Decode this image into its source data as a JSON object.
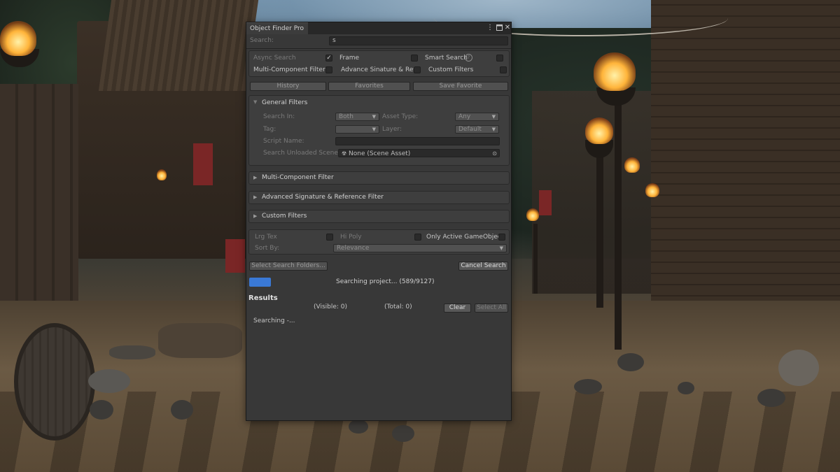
{
  "window": {
    "tab_title": "Object Finder Pro",
    "menu_icon": "kebab-menu-icon",
    "maximize_icon": "maximize-icon",
    "close_icon": "close-icon",
    "close_glyph": "✕"
  },
  "search": {
    "label": "Search:",
    "value": "s"
  },
  "options": {
    "async_search": {
      "label": "Async Search",
      "checked": true,
      "check_glyph": "✓"
    },
    "frame": {
      "label": "Frame",
      "checked": false
    },
    "smart_search": {
      "label": "Smart Search",
      "checked": false,
      "help_icon": "help-icon",
      "help_glyph": "?"
    },
    "multi_component_filter": {
      "label": "Multi-Component Filter",
      "checked": false
    },
    "advance_signature_ref": {
      "label": "Advance Sinature & Ref",
      "checked": false
    },
    "custom_filters": {
      "label": "Custom Filters",
      "checked": false
    }
  },
  "toolbar": {
    "history": "History",
    "favorites": "Favorites",
    "save_favorite": "Save Favorite"
  },
  "general_filters": {
    "title": "General Filters",
    "expanded": true,
    "search_in_label": "Search In:",
    "search_in_value": "Both",
    "asset_type_label": "Asset Type:",
    "asset_type_value": "Any",
    "tag_label": "Tag:",
    "tag_value": "",
    "layer_label": "Layer:",
    "layer_value": "Default",
    "script_name_label": "Script Name:",
    "script_name_value": "",
    "unloaded_scene_label": "Search Unloaded Scene:",
    "unloaded_scene_value": "None (Scene Asset)",
    "scene_icon": "scene-asset-icon",
    "picker_icon": "object-picker-icon"
  },
  "sections": [
    {
      "title": "Multi-Component Filter",
      "expanded": false
    },
    {
      "title": "Advanced Signature & Reference Filter",
      "expanded": false
    },
    {
      "title": "Custom Filters",
      "expanded": false
    }
  ],
  "extra_options": {
    "lrg_tex": "Lrg Tex",
    "hi_poly": "Hi Poly",
    "only_active": "Only Active GameObject",
    "sort_by_label": "Sort By:",
    "sort_by_value": "Relevance"
  },
  "actions": {
    "select_folders": "Select Search Folders...",
    "cancel_search": "Cancel Search"
  },
  "progress": {
    "fraction": 0.0646,
    "status": "Searching project... (589/9127)",
    "color": "#3a79d6"
  },
  "results": {
    "title": "Results",
    "visible": "(Visible: 0)",
    "total": "(Total: 0)",
    "clear": "Clear",
    "select_all": "Select All",
    "status": "Searching -..."
  }
}
